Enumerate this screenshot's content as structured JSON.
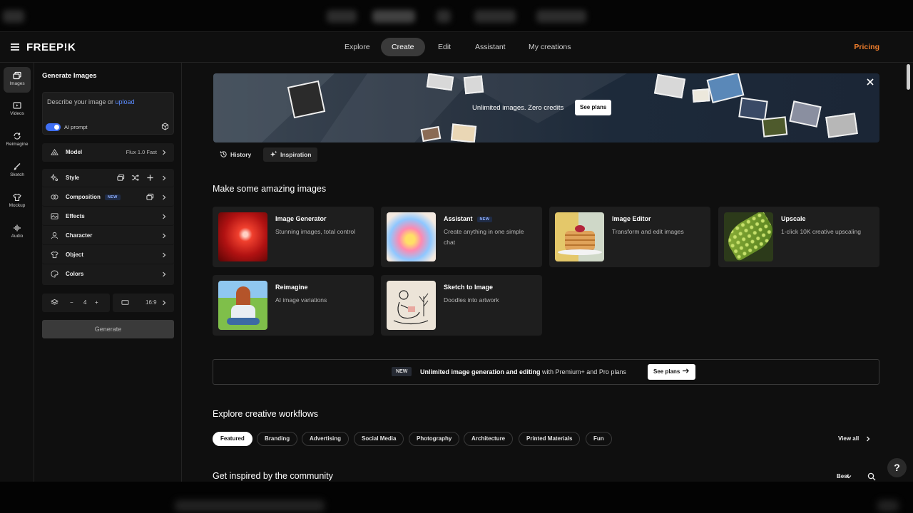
{
  "nav": {
    "logo": "FREEP!K",
    "tabs": [
      {
        "label": "Explore"
      },
      {
        "label": "Create"
      },
      {
        "label": "Edit"
      },
      {
        "label": "Assistant"
      },
      {
        "label": "My creations"
      }
    ],
    "active_tab": "Create",
    "pricing": "Pricing"
  },
  "rail": {
    "items": [
      {
        "label": "Images",
        "icon": "images-icon"
      },
      {
        "label": "Videos",
        "icon": "video-icon"
      },
      {
        "label": "Reimagine",
        "icon": "refresh-icon"
      },
      {
        "label": "Sketch",
        "icon": "brush-icon"
      },
      {
        "label": "Mockup",
        "icon": "shirt-icon"
      },
      {
        "label": "Audio",
        "icon": "audio-wave-icon"
      }
    ]
  },
  "panel": {
    "title": "Generate Images",
    "prompt_placeholder": "Describe your image or ",
    "prompt_upload": "upload",
    "ai_prompt": "AI prompt",
    "model_label": "Model",
    "model_value": "Flux 1.0 Fast",
    "options": [
      {
        "label": "Style"
      },
      {
        "label": "Composition",
        "badge": "NEW"
      },
      {
        "label": "Effects"
      },
      {
        "label": "Character"
      },
      {
        "label": "Object"
      },
      {
        "label": "Colors"
      }
    ],
    "count": "4",
    "minus": "−",
    "plus": "+",
    "aspect": "16:9",
    "generate": "Generate"
  },
  "banner": {
    "text": "Unlimited images. Zero credits",
    "button": "See plans"
  },
  "subtabs": [
    {
      "label": "History"
    },
    {
      "label": "Inspiration"
    }
  ],
  "section_title": "Make some amazing images",
  "tools": [
    {
      "title": "Image Generator",
      "desc": "Stunning images, total control"
    },
    {
      "title": "Assistant",
      "badge": "NEW",
      "desc": "Create anything in one simple chat"
    },
    {
      "title": "Image Editor",
      "desc": "Transform and edit images"
    },
    {
      "title": "Upscale",
      "desc": "1-click 10K creative upscaling"
    },
    {
      "title": "Reimagine",
      "desc": "AI image variations"
    },
    {
      "title": "Sketch to Image",
      "desc": "Doodles into artwork"
    }
  ],
  "promo": {
    "badge": "NEW",
    "bold": "Unlimited image generation and editing",
    "rest": " with Premium+ and Pro plans",
    "button": "See plans"
  },
  "workflows": {
    "title": "Explore creative workflows",
    "chips": [
      "Featured",
      "Branding",
      "Advertising",
      "Social Media",
      "Photography",
      "Architecture",
      "Printed Materials",
      "Fun"
    ],
    "view_all": "View all"
  },
  "community": {
    "title": "Get inspired by the community",
    "sort": "Best"
  },
  "help": "?",
  "colors": {
    "accent": "#3f6ff5",
    "pricing": "#f07e2c",
    "link": "#5b8cff"
  }
}
